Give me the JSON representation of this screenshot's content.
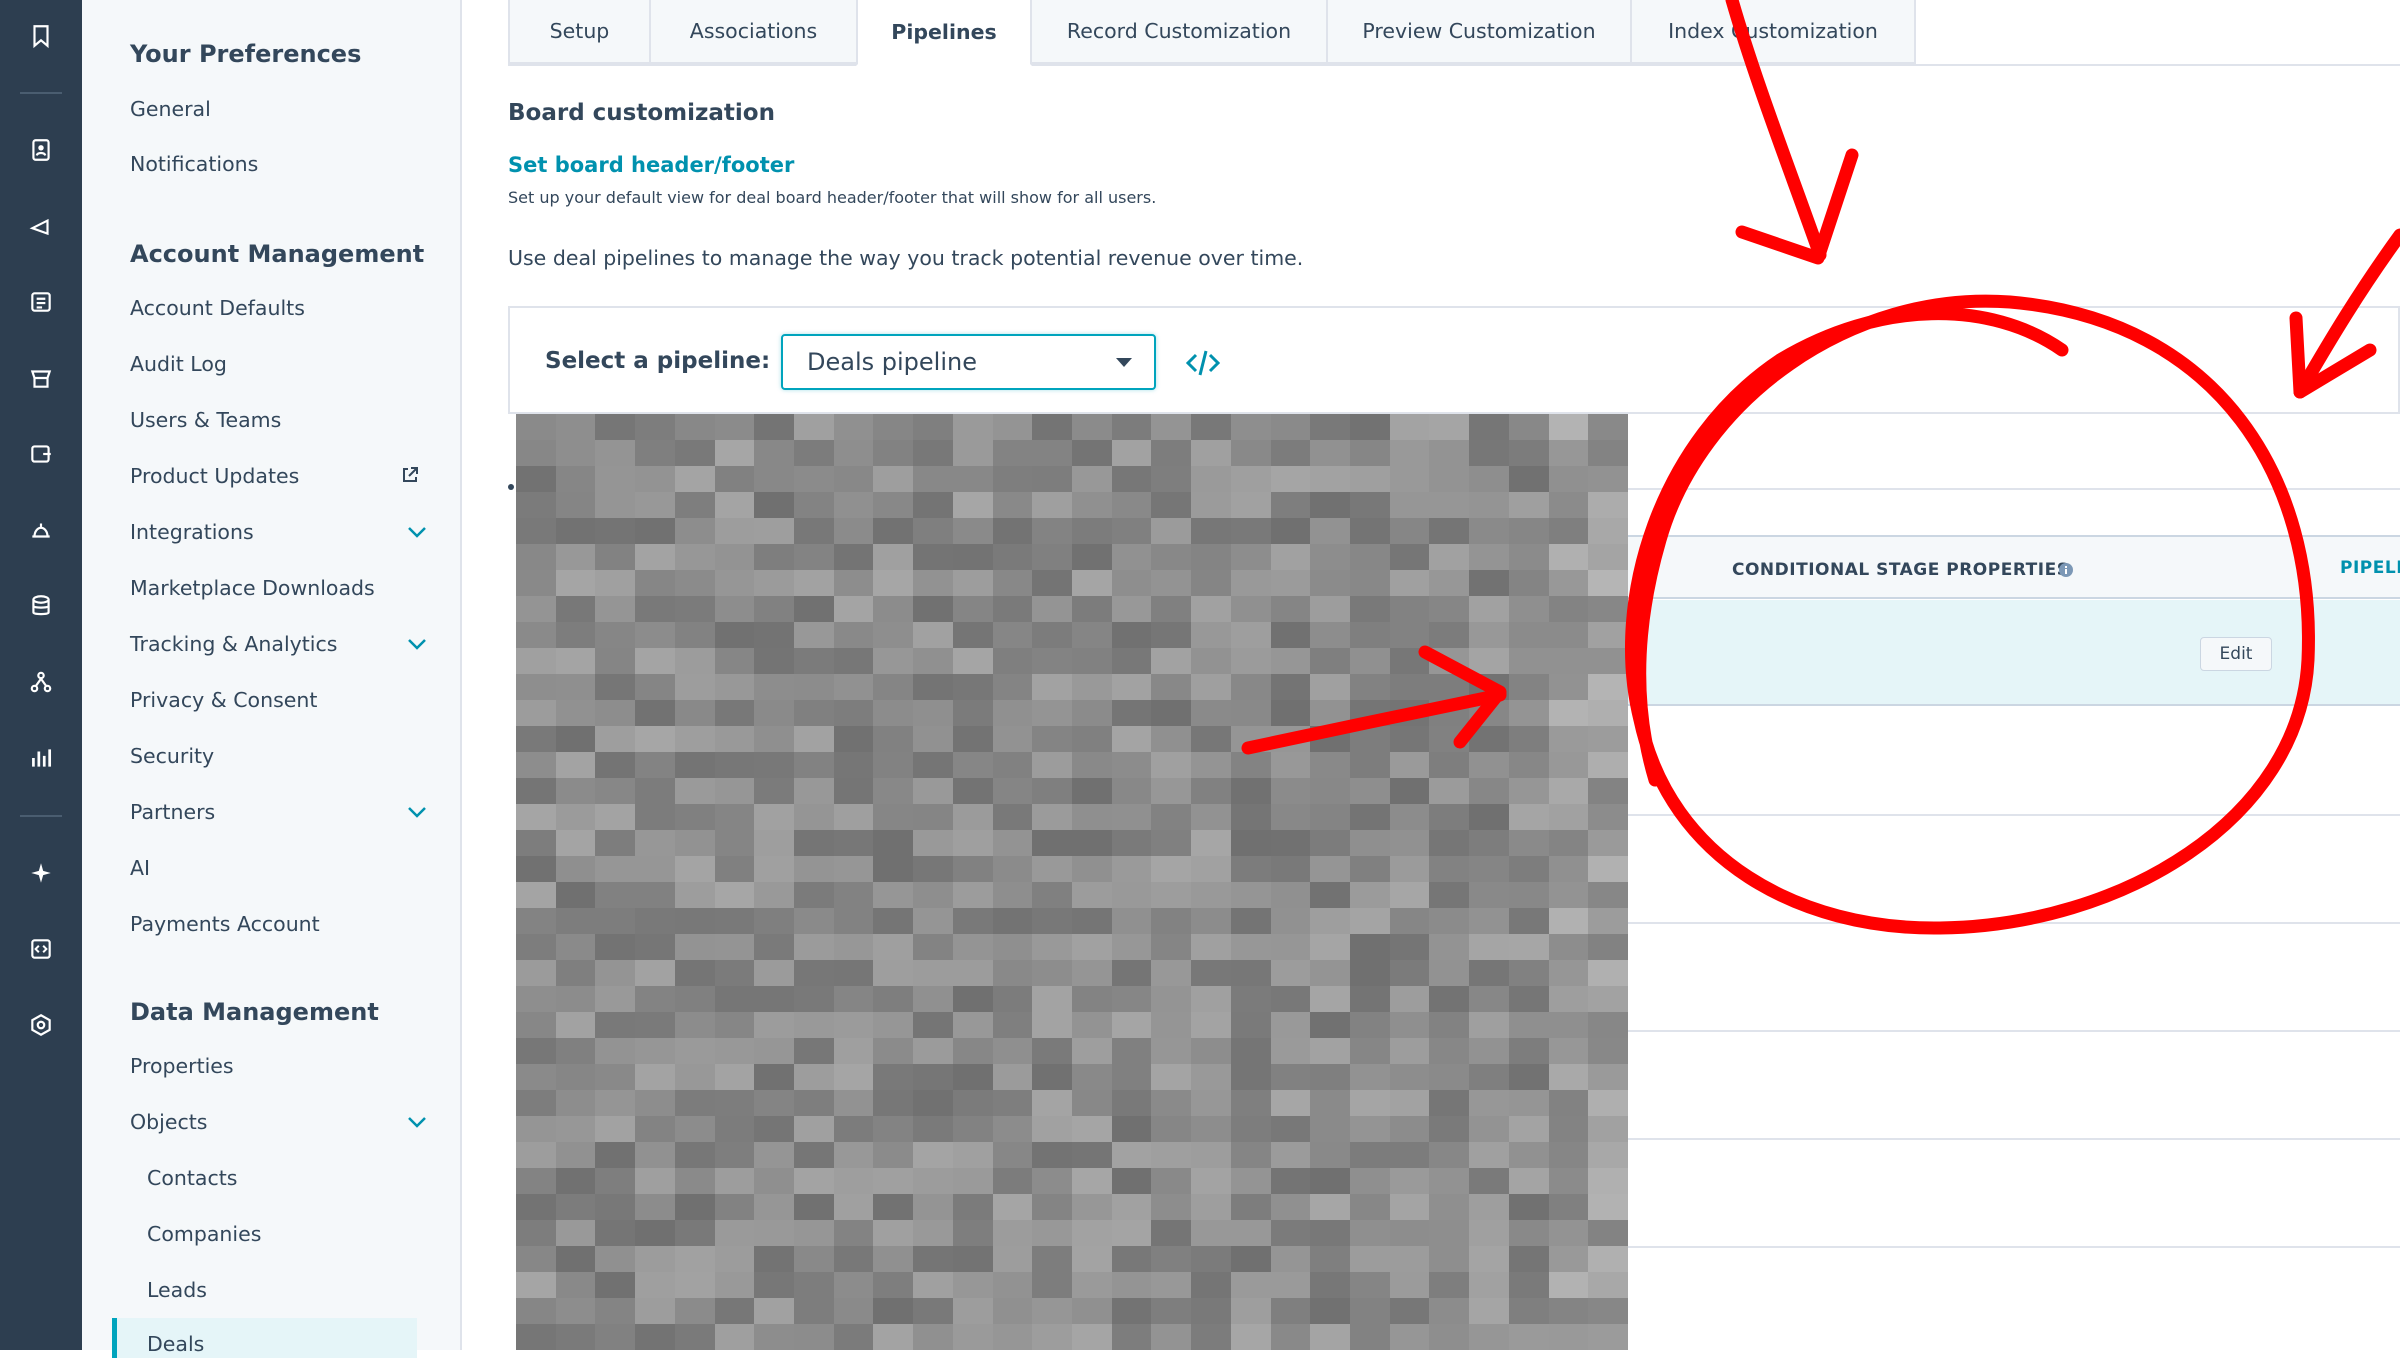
{
  "sidebar": {
    "sections": [
      {
        "title": "Your Preferences"
      },
      {
        "title": "Account Management"
      },
      {
        "title": "Data Management"
      }
    ],
    "preferences": [
      "General",
      "Notifications"
    ],
    "account": [
      "Account Defaults",
      "Audit Log",
      "Users & Teams",
      "Product Updates",
      "Integrations",
      "Marketplace Downloads",
      "Tracking & Analytics",
      "Privacy & Consent",
      "Security",
      "Partners",
      "AI",
      "Payments Account"
    ],
    "data": [
      "Properties",
      "Objects"
    ],
    "objects": [
      "Contacts",
      "Companies",
      "Leads",
      "Deals"
    ]
  },
  "tabs": [
    "Setup",
    "Associations",
    "Pipelines",
    "Record Customization",
    "Preview Customization",
    "Index Customization"
  ],
  "active_tab": "Pipelines",
  "main": {
    "board_title": "Board customization",
    "board_link": "Set board header/footer",
    "board_desc": "Set up your default view for deal board header/footer that will show for all users.",
    "pipelines_desc": "Use deal pipelines to manage the way you track potential revenue over time.",
    "select_label": "Select a pipeline:",
    "select_value": "Deals pipeline"
  },
  "table": {
    "col1": "CONDITIONAL STAGE PROPERTIES",
    "col2": "PIPELI",
    "edit_label": "Edit"
  },
  "colors": {
    "rail": "#2d3e50",
    "accent": "#00a4bd",
    "link": "#0091ae",
    "annotation": "#ff0000"
  }
}
